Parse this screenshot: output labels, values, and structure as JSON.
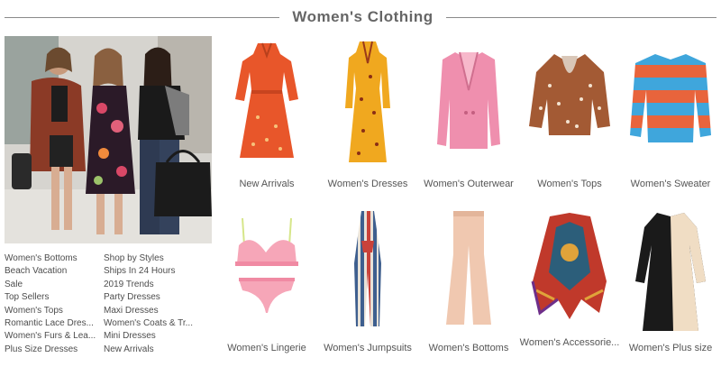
{
  "header": {
    "title": "Women's Clothing"
  },
  "links": {
    "col1": [
      "Women's Bottoms",
      "Beach Vacation",
      "Sale",
      "Top Sellers",
      "Women's Tops",
      "Romantic Lace Dres...",
      "Women's Furs & Lea...",
      "Plus Size Dresses"
    ],
    "col2": [
      "Shop by Styles",
      "Ships In 24 Hours",
      "2019 Trends",
      "Party Dresses",
      "Maxi Dresses",
      "Women's Coats & Tr...",
      "Mini Dresses",
      "New Arrivals"
    ]
  },
  "categories": [
    {
      "label": "New Arrivals",
      "icon": "orange-dress-icon",
      "color": "#e8562a"
    },
    {
      "label": "Women's Dresses",
      "icon": "yellow-dress-icon",
      "color": "#f0a81f"
    },
    {
      "label": "Women's Outerwear",
      "icon": "pink-blazer-icon",
      "color": "#ef8fae"
    },
    {
      "label": "Women's Tops",
      "icon": "polka-dot-blouse-icon",
      "color": "#a35a34"
    },
    {
      "label": "Women's Sweater",
      "icon": "striped-sweater-icon",
      "color": "#3fa6dc"
    },
    {
      "label": "Women's Lingerie",
      "icon": "lingerie-set-icon",
      "color": "#f6a6b8"
    },
    {
      "label": "Women's Jumpsuits",
      "icon": "striped-jumpsuit-icon",
      "color": "#4a6fa5"
    },
    {
      "label": "Women's Bottoms",
      "icon": "flared-pants-icon",
      "color": "#f0c8b0"
    },
    {
      "label": "Women's Accessorie...",
      "icon": "printed-scarf-icon",
      "color": "#c0392b"
    },
    {
      "label": "Women's Plus size",
      "icon": "black-wrap-dress-icon",
      "color": "#1a1a1a"
    }
  ]
}
